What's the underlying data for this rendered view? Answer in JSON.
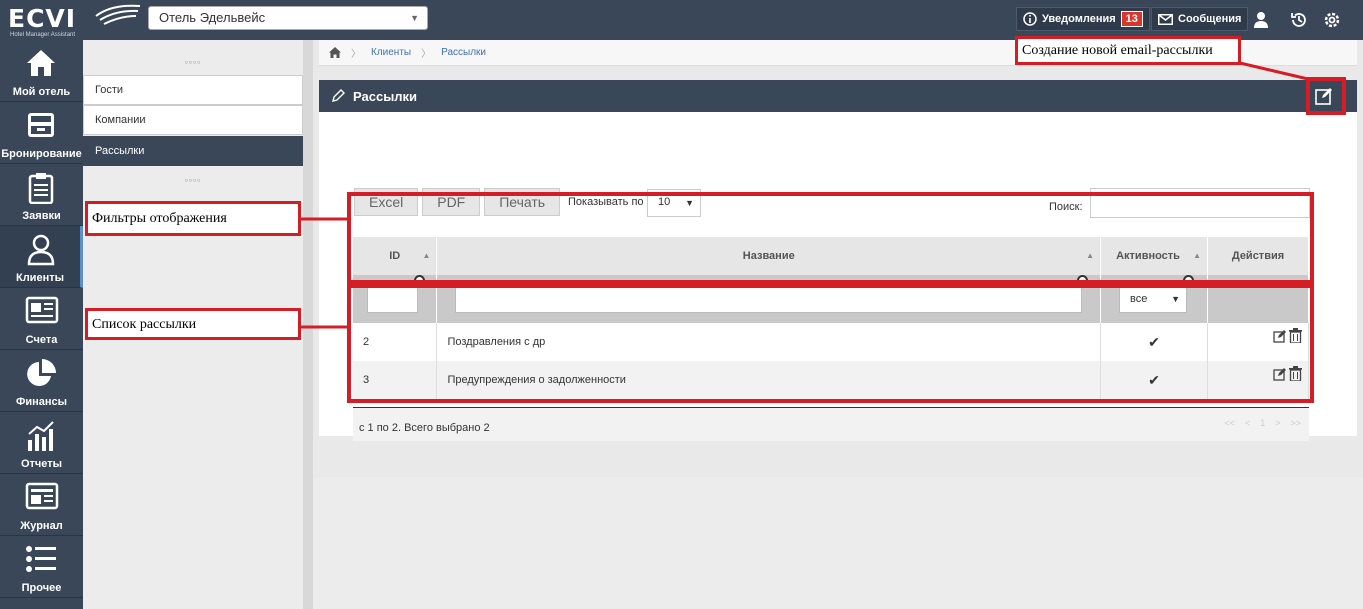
{
  "app": {
    "logo": "ECVI",
    "logo_subtitle": "Hotel Manager Assistant"
  },
  "topbar": {
    "hotel": "Отель Эдельвейс",
    "notifications_label": "Уведомления",
    "notifications_count": "13",
    "messages_label": "Сообщения"
  },
  "leftnav": {
    "items": [
      {
        "label": "Мой отель",
        "icon": "home-icon"
      },
      {
        "label": "Бронирование",
        "icon": "inbox-icon"
      },
      {
        "label": "Заявки",
        "icon": "clipboard-icon"
      },
      {
        "label": "Клиенты",
        "icon": "user-icon",
        "active": true
      },
      {
        "label": "Счета",
        "icon": "invoice-icon"
      },
      {
        "label": "Финансы",
        "icon": "pie-chart-icon"
      },
      {
        "label": "Отчеты",
        "icon": "bar-chart-icon"
      },
      {
        "label": "Журнал",
        "icon": "journal-icon"
      },
      {
        "label": "Прочее",
        "icon": "list-icon"
      }
    ]
  },
  "subnav": {
    "items": [
      {
        "label": "Гости"
      },
      {
        "label": "Компании"
      },
      {
        "label": "Рассылки",
        "active": true
      }
    ]
  },
  "breadcrumb": {
    "items": [
      "Клиенты",
      "Рассылки"
    ]
  },
  "panel": {
    "title": "Рассылки",
    "export": {
      "excel": "Excel",
      "pdf": "PDF",
      "print": "Печать"
    },
    "show_per_page_label": "Показывать по",
    "per_page": "10",
    "search_label": "Поиск:",
    "search_value": ""
  },
  "table": {
    "headers": {
      "id": "ID",
      "name": "Название",
      "active": "Активность",
      "actions": "Действия"
    },
    "filter_active": "все",
    "rows": [
      {
        "id": "2",
        "name": "Поздравления с др",
        "active": "✔"
      },
      {
        "id": "3",
        "name": "Предупреждения о задолженности",
        "active": "✔"
      }
    ],
    "footer": "с 1 по 2. Всего выбрано 2",
    "pager": {
      "first": "<<",
      "prev": "<",
      "page": "1",
      "next": ">",
      "last": ">>"
    }
  },
  "annotations": {
    "create_new": "Создание новой email-рассылки",
    "filters": "Фильтры отображения",
    "list": "Список рассылки"
  },
  "colors": {
    "navy": "#3a4759",
    "annotation_red": "#d41d24",
    "badge_red": "#d9352b"
  }
}
